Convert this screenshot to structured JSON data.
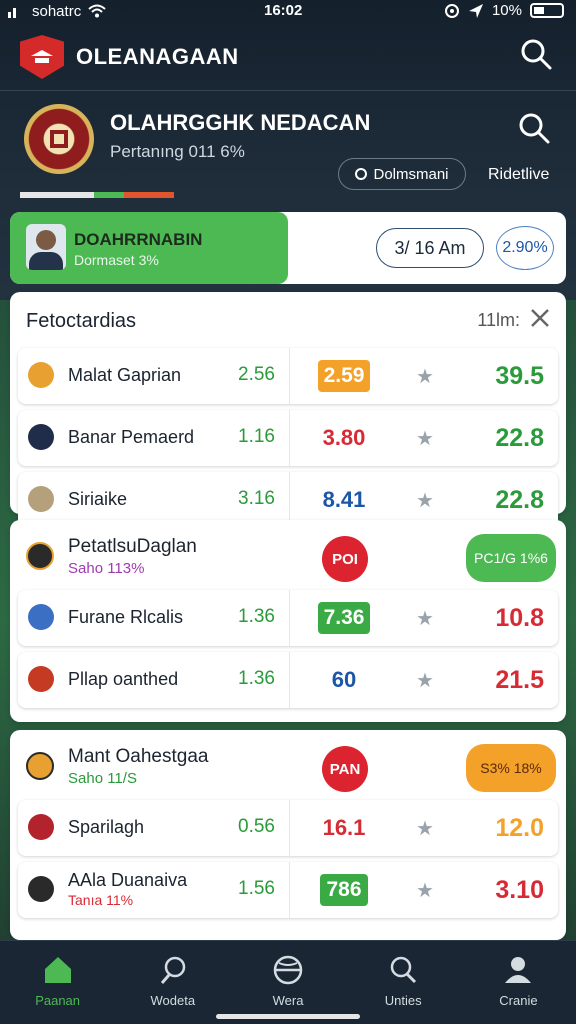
{
  "status": {
    "carrier": "sohatrc",
    "time": "16:02",
    "battery": "10%"
  },
  "app": {
    "title": "OLEANAGAAN"
  },
  "club": {
    "name": "OLAHRGGHK NEDACAN",
    "subtitle": "Pertanıng 011 6%",
    "filter_label": "Dolmsmani",
    "live_label": "Ridetlive",
    "strip_colors": [
      "#e6e6e6",
      "#e6e6e6",
      "#4cb953",
      "#e0552b"
    ]
  },
  "feature": {
    "name": "DOAHRRNABIN",
    "subtitle": "Dormaset 3%",
    "time": "3/ 16 Am",
    "percent": "2.90%"
  },
  "section1": {
    "title": "Fetoctardias",
    "meta": "11lm:",
    "rows": [
      {
        "team": "Malat Gaprian",
        "left": "2.56",
        "mid": "2.59",
        "mid_style": "box",
        "mid_color": "#f4a12a",
        "right": "39.5",
        "right_color": "#2a9a3a",
        "icon_color": "#e8a030"
      },
      {
        "team": "Banar Pemaerd",
        "left": "1.16",
        "mid": "3.80",
        "mid_style": "text",
        "mid_color": "#d62b35",
        "right": "22.8",
        "right_color": "#2a9a3a",
        "icon_color": "#1f2d4a"
      },
      {
        "team": "Siriaike",
        "left": "3.16",
        "mid": "8.41",
        "mid_style": "text",
        "mid_color": "#1c56a8",
        "right": "22.8",
        "right_color": "#2a9a3a",
        "icon_color": "#b4a07a"
      }
    ]
  },
  "section2": {
    "title": "PetatlsuDaglan",
    "subtitle": "Saho 113%",
    "subtitle_color": "#a03ab3",
    "circle": "POI",
    "pill": "PC1/G 1%6",
    "pill_color": "#4cb953",
    "rows": [
      {
        "team": "Furane Rlcalis",
        "left": "1.36",
        "mid": "7.36",
        "mid_style": "box",
        "mid_color": "#3aaa44",
        "right": "10.8",
        "right_color": "#d62b35",
        "icon_color": "#3b6fc4"
      },
      {
        "team": "Pllap oanthed",
        "left": "1.36",
        "mid": "60",
        "mid_style": "text",
        "mid_color": "#1c56a8",
        "right": "21.5",
        "right_color": "#d62b35",
        "icon_color": "#c43a22"
      }
    ]
  },
  "section3": {
    "title": "Mant Oahestgaa",
    "subtitle": "Saho 11/S",
    "subtitle_color": "#2a9a3a",
    "circle": "PAN",
    "pill": "S3% 18%",
    "pill_color": "#f4a12a",
    "rows": [
      {
        "team": "Sparilagh",
        "left": "0.56",
        "mid": "16.1",
        "mid_style": "text",
        "mid_color": "#d62b35",
        "right": "12.0",
        "right_color": "#f4a12a",
        "icon_color": "#b3232e"
      },
      {
        "team": "AAla Duanaiva",
        "sub": "Tanıa 11%",
        "left": "1.56",
        "mid": "786",
        "mid_style": "box",
        "mid_color": "#3aaa44",
        "right": "3.10",
        "right_color": "#d62b35",
        "icon_color": "#2a2a2a"
      }
    ]
  },
  "nav": [
    {
      "label": "Paanan",
      "icon": "home-icon"
    },
    {
      "label": "Wodeta",
      "icon": "rocket-icon"
    },
    {
      "label": "Wera",
      "icon": "ball-icon"
    },
    {
      "label": "Unties",
      "icon": "search-icon"
    },
    {
      "label": "Cranie",
      "icon": "user-icon"
    }
  ]
}
